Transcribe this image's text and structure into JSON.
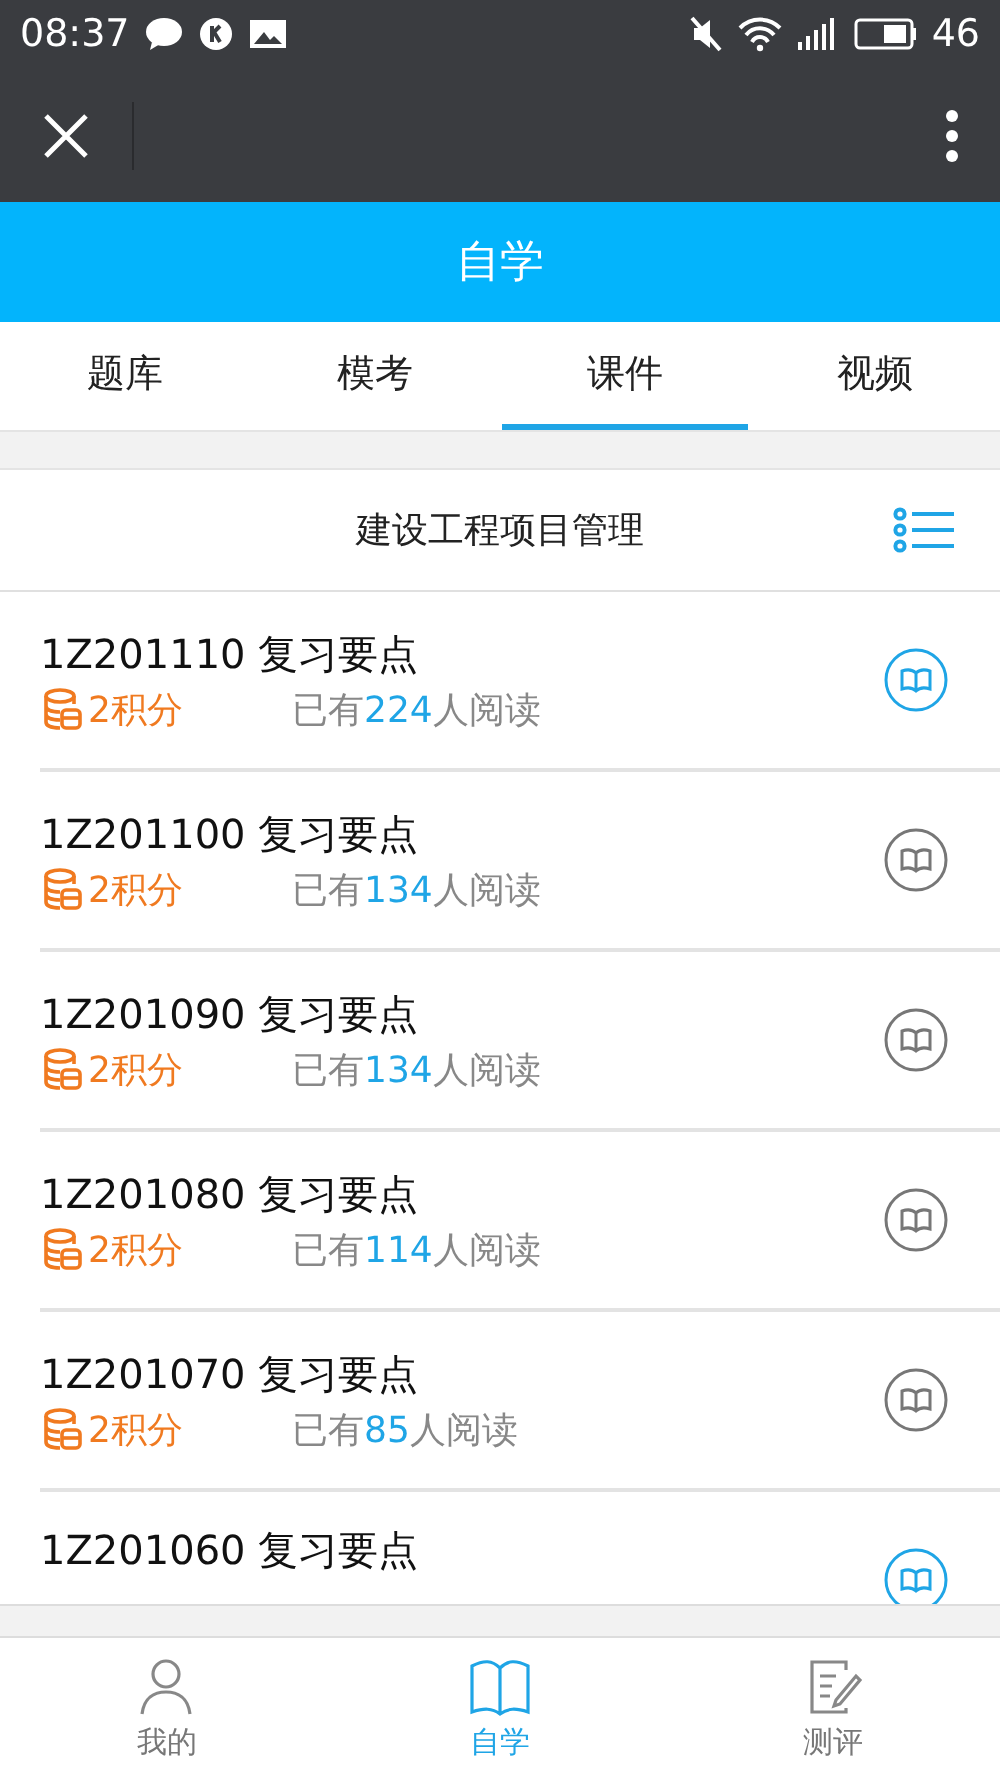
{
  "status_bar": {
    "time": "08:37",
    "battery": "46"
  },
  "header": {
    "title": "自学"
  },
  "tabs": [
    {
      "label": "题库",
      "selected": false
    },
    {
      "label": "模考",
      "selected": false
    },
    {
      "label": "课件",
      "selected": true
    },
    {
      "label": "视频",
      "selected": false
    }
  ],
  "course": {
    "title": "建设工程项目管理"
  },
  "items": [
    {
      "title": "1Z201110 复习要点",
      "points": "2积分",
      "read_prefix": "已有",
      "read_count": "224",
      "read_suffix": "人阅读",
      "highlighted": true
    },
    {
      "title": "1Z201100 复习要点",
      "points": "2积分",
      "read_prefix": "已有",
      "read_count": "134",
      "read_suffix": "人阅读",
      "highlighted": false
    },
    {
      "title": "1Z201090 复习要点",
      "points": "2积分",
      "read_prefix": "已有",
      "read_count": "134",
      "read_suffix": "人阅读",
      "highlighted": false
    },
    {
      "title": "1Z201080 复习要点",
      "points": "2积分",
      "read_prefix": "已有",
      "read_count": "114",
      "read_suffix": "人阅读",
      "highlighted": false
    },
    {
      "title": "1Z201070 复习要点",
      "points": "2积分",
      "read_prefix": "已有",
      "read_count": "85",
      "read_suffix": "人阅读",
      "highlighted": false
    },
    {
      "title": "1Z201060 复习要点",
      "highlighted": true
    }
  ],
  "bottom_nav": [
    {
      "label": "我的",
      "kind": "person",
      "selected": false
    },
    {
      "label": "自学",
      "kind": "book",
      "selected": true
    },
    {
      "label": "测评",
      "kind": "test",
      "selected": false
    }
  ]
}
